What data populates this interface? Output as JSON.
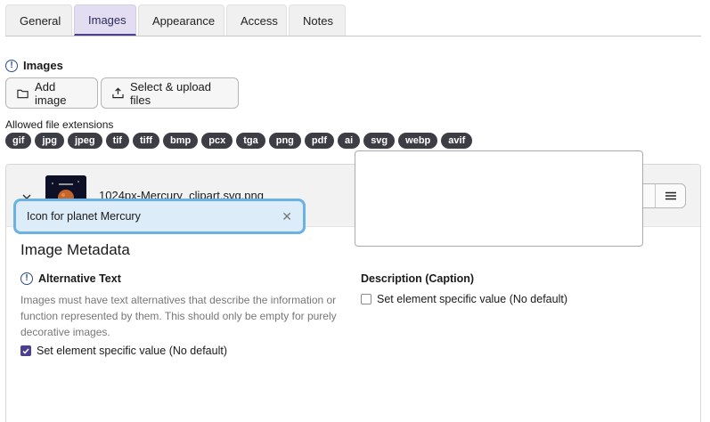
{
  "tabs": [
    {
      "label": "General"
    },
    {
      "label": "Images"
    },
    {
      "label": "Appearance"
    },
    {
      "label": "Access"
    },
    {
      "label": "Notes"
    }
  ],
  "section": {
    "title": "Images"
  },
  "buttons": {
    "add_image": "Add image",
    "upload": "Select & upload files"
  },
  "allowed": {
    "label": "Allowed file extensions",
    "extensions": [
      "gif",
      "jpg",
      "jpeg",
      "tif",
      "tiff",
      "bmp",
      "pcx",
      "tga",
      "png",
      "pdf",
      "ai",
      "svg",
      "webp",
      "avif"
    ]
  },
  "image_item": {
    "filename": "1024px-Mercury_clipart.svg.png",
    "metadata_title": "Image Metadata",
    "alt_text": {
      "label": "Alternative Text",
      "help": "Images must have text alternatives that describe the information or function represented by them. This should only be empty for purely decorative images.",
      "checkbox_label": "Set element specific value (No default)",
      "value": "Icon for planet Mercury"
    },
    "description": {
      "label": "Description (Caption)",
      "checkbox_label": "Set element specific value (No default)",
      "value": ""
    }
  },
  "colors": {
    "accent": "#4b3f8f",
    "focus": "#6bb2e4",
    "badge": "#3d3d45"
  }
}
